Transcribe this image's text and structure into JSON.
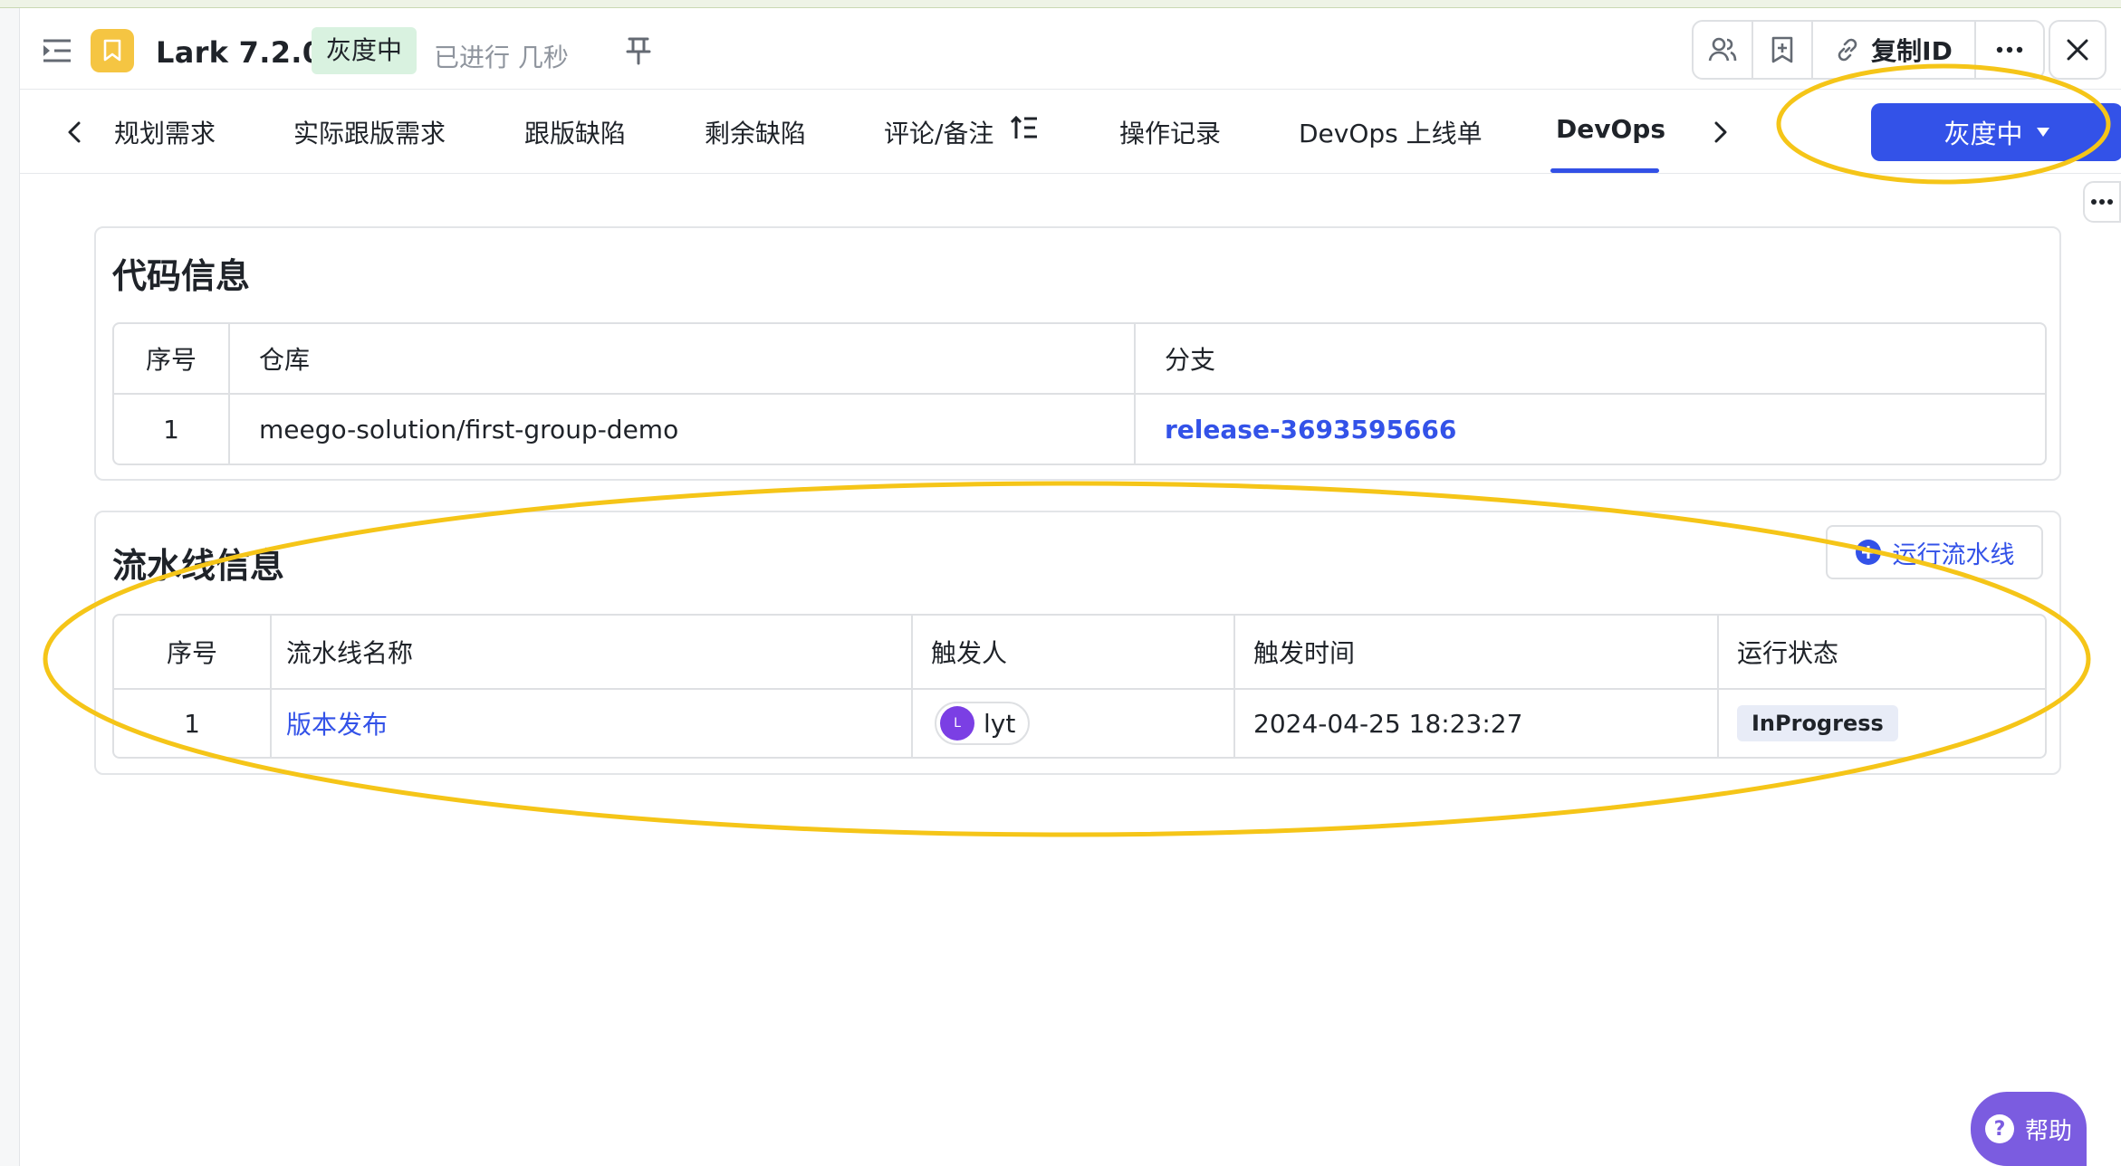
{
  "header": {
    "title": "Lark 7.2.0",
    "status": "灰度中",
    "elapsed": "已进行 几秒",
    "copy_id": "复制ID",
    "icons": [
      "sidebar-toggle-icon",
      "bookmark-icon",
      "pin-icon",
      "members-icon",
      "add-bookmark-icon",
      "link-icon",
      "more-icon",
      "close-icon"
    ]
  },
  "tabs": [
    {
      "label": "规划需求"
    },
    {
      "label": "实际跟版需求"
    },
    {
      "label": "跟版缺陷"
    },
    {
      "label": "剩余缺陷"
    },
    {
      "label": "评论/备注"
    },
    {
      "label": "操作记录"
    },
    {
      "label": "DevOps 上线单"
    },
    {
      "label": "DevOps",
      "active": true
    }
  ],
  "primary_button": {
    "label": "灰度中"
  },
  "code_info": {
    "title": "代码信息",
    "columns": [
      "序号",
      "仓库",
      "分支"
    ],
    "rows": [
      {
        "index": "1",
        "repo": "meego-solution/first-group-demo",
        "branch": "release-3693595666"
      }
    ]
  },
  "pipeline_info": {
    "title": "流水线信息",
    "run_button": "运行流水线",
    "columns": [
      "序号",
      "流水线名称",
      "触发人",
      "触发时间",
      "运行状态"
    ],
    "rows": [
      {
        "index": "1",
        "name": "版本发布",
        "avatar_initial": "L",
        "trigger_user": "lyt",
        "trigger_time": "2024-04-25 18:23:27",
        "status": "InProgress"
      }
    ]
  },
  "help": {
    "label": "帮助",
    "glyph": "?"
  },
  "colors": {
    "accent": "#3352e8",
    "status_tag_bg": "#d9f2e0",
    "annotation": "#f5c518",
    "app_badge": "#f5c542",
    "avatar": "#7b3fe4",
    "help": "#7b5ce0"
  }
}
